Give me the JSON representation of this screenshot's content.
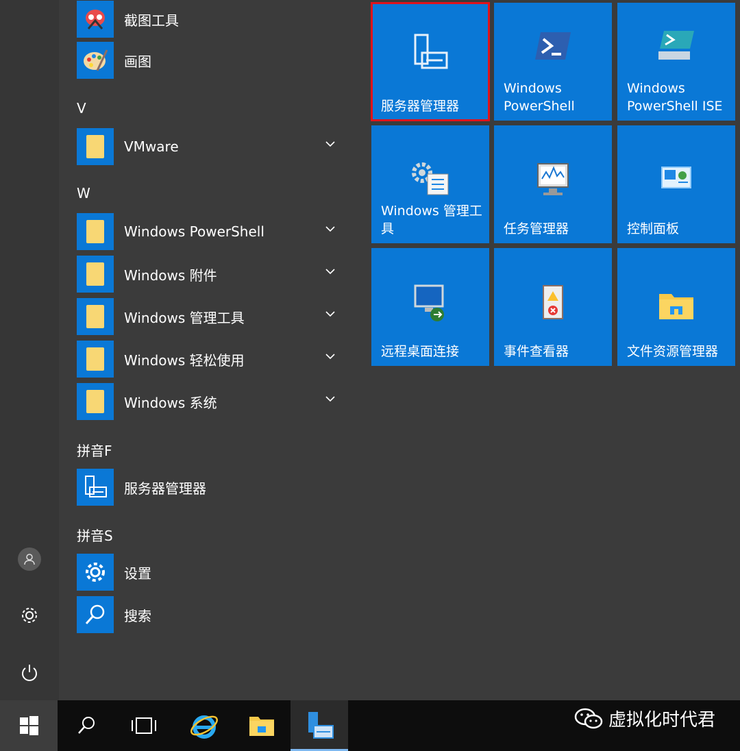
{
  "start_menu": {
    "rail": {
      "user_icon": "user-icon",
      "settings_icon": "gear-icon",
      "power_icon": "power-icon"
    },
    "apps": [
      {
        "label": "截图工具",
        "icon": "snipping-tool-icon"
      },
      {
        "label": "画图",
        "icon": "paint-icon"
      }
    ],
    "groups": [
      {
        "letter": "V",
        "items": [
          {
            "label": "VMware",
            "icon": "folder-icon",
            "expandable": true
          }
        ]
      },
      {
        "letter": "W",
        "items": [
          {
            "label": "Windows PowerShell",
            "icon": "folder-icon",
            "expandable": true
          },
          {
            "label": "Windows 附件",
            "icon": "folder-icon",
            "expandable": true
          },
          {
            "label": "Windows 管理工具",
            "icon": "folder-icon",
            "expandable": true
          },
          {
            "label": "Windows 轻松使用",
            "icon": "folder-icon",
            "expandable": true
          },
          {
            "label": "Windows 系统",
            "icon": "folder-icon",
            "expandable": true
          }
        ]
      },
      {
        "letter": "拼音F",
        "items": [
          {
            "label": "服务器管理器",
            "icon": "server-manager-icon"
          }
        ]
      },
      {
        "letter": "拼音S",
        "items": [
          {
            "label": "设置",
            "icon": "gear-icon"
          },
          {
            "label": "搜索",
            "icon": "search-icon"
          }
        ]
      }
    ],
    "tiles": [
      {
        "label": "服务器管理器",
        "icon": "server-manager-icon",
        "selected": true
      },
      {
        "label": "Windows PowerShell",
        "icon": "powershell-icon"
      },
      {
        "label": "Windows PowerShell ISE",
        "icon": "powershell-ise-icon"
      },
      {
        "label": "Windows 管理工具",
        "icon": "admin-tools-icon"
      },
      {
        "label": "任务管理器",
        "icon": "task-manager-icon"
      },
      {
        "label": "控制面板",
        "icon": "control-panel-icon"
      },
      {
        "label": "远程桌面连接",
        "icon": "remote-desktop-icon"
      },
      {
        "label": "事件查看器",
        "icon": "event-viewer-icon"
      },
      {
        "label": "文件资源管理器",
        "icon": "file-explorer-icon"
      }
    ]
  },
  "taskbar": {
    "items": [
      "windows-start-icon",
      "search-icon",
      "task-view-icon",
      "internet-explorer-icon",
      "file-explorer-icon",
      "server-manager-icon"
    ],
    "active": "server-manager-icon"
  },
  "watermark": {
    "text": "虚拟化时代君",
    "icon": "wechat-icon"
  },
  "colors": {
    "tile_blue": "#0a78d6",
    "folder_yellow": "#f8d774",
    "selection_red": "#e0131c"
  }
}
